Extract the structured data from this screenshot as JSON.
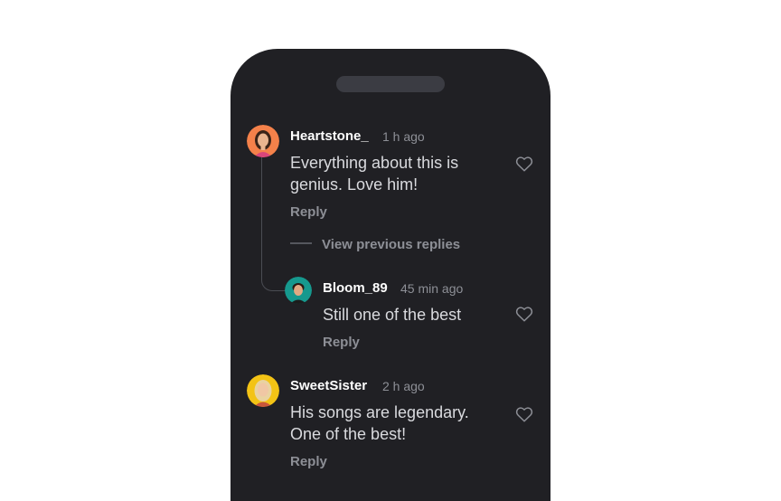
{
  "comments": [
    {
      "username": "Heartstone_",
      "time": "1 h ago",
      "text_line1": "Everything about this is",
      "text_line2": "genius. Love him!",
      "reply": "Reply"
    },
    {
      "username": "Bloom_89",
      "time": "45 min ago",
      "text_line1": "Still one of the best",
      "reply": "Reply"
    },
    {
      "username": "SweetSister",
      "time": "2 h ago",
      "text_line1": "His songs are legendary.",
      "text_line2": "One of the best!",
      "reply": "Reply"
    }
  ],
  "thread": {
    "view_previous_replies": "View previous replies"
  },
  "colors": {
    "background": "#ffffff",
    "panel": "#202024",
    "avatar_1": "#f4814a",
    "avatar_2": "#16998e",
    "avatar_3": "#f3c315"
  },
  "icons": [
    "heart-icon",
    "avatar"
  ]
}
